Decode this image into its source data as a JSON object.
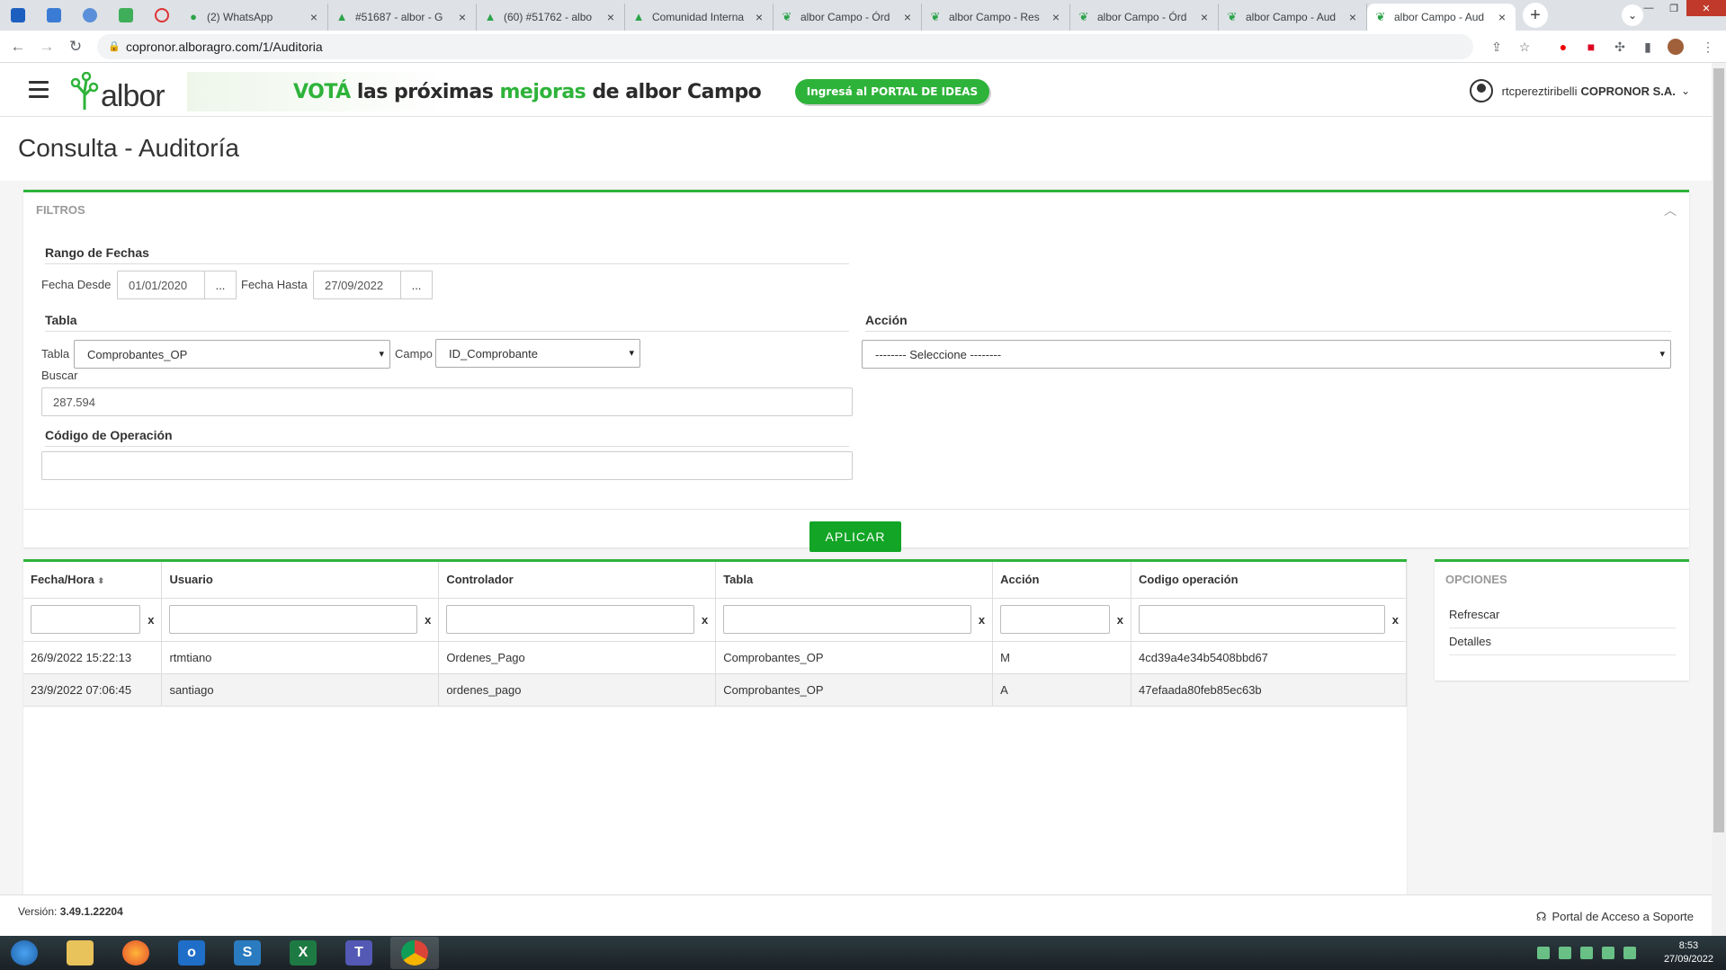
{
  "browser": {
    "tabs": [
      {
        "title": "(2) WhatsApp",
        "icon": "whatsapp-icon"
      },
      {
        "title": "#51687 - albor - G",
        "icon": "albor-icon"
      },
      {
        "title": "(60) #51762 - albo",
        "icon": "albor-icon"
      },
      {
        "title": "Comunidad Interna",
        "icon": "albor-icon"
      },
      {
        "title": "albor Campo - Órd",
        "icon": "sprout-icon"
      },
      {
        "title": "albor Campo - Res",
        "icon": "sprout-icon"
      },
      {
        "title": "albor Campo - Órd",
        "icon": "sprout-icon"
      },
      {
        "title": "albor Campo - Aud",
        "icon": "sprout-icon"
      },
      {
        "title": "albor Campo - Aud",
        "icon": "sprout-icon",
        "active": true
      }
    ],
    "url": "copronor.alboragro.com/1/Auditoria"
  },
  "header": {
    "logo_text": "albor",
    "banner": {
      "lead": "VOTÁ",
      "text_1": "las próximas",
      "highlight": "mejoras",
      "text_2": "de albor Campo",
      "cta": "Ingresá al PORTAL DE IDEAS"
    },
    "user_name": "rtcpereztiribelli",
    "company": "COPRONOR S.A."
  },
  "page": {
    "title": "Consulta - Auditoría"
  },
  "filters": {
    "title": "FILTROS",
    "rango_title": "Rango de Fechas",
    "fecha_desde_label": "Fecha Desde",
    "fecha_desde": "01/01/2020",
    "fecha_hasta_label": "Fecha Hasta",
    "fecha_hasta": "27/09/2022",
    "picker_label": "...",
    "tabla_title": "Tabla",
    "tabla_label": "Tabla",
    "tabla_value": "Comprobantes_OP",
    "campo_label": "Campo",
    "campo_value": "ID_Comprobante",
    "buscar_label": "Buscar",
    "buscar_value": "287.594",
    "accion_title": "Acción",
    "accion_value": "-------- Seleccione --------",
    "codigo_title": "Código de Operación",
    "codigo_value": "",
    "apply_label": "APLICAR"
  },
  "grid": {
    "columns": [
      "Fecha/Hora",
      "Usuario",
      "Controlador",
      "Tabla",
      "Acción",
      "Codigo operación"
    ],
    "clear_label": "x",
    "rows": [
      [
        "26/9/2022 15:22:13",
        "rtmtiano",
        "Ordenes_Pago",
        "Comprobantes_OP",
        "M",
        "4cd39a4e34b5408bbd67"
      ],
      [
        "23/9/2022 07:06:45",
        "santiago",
        "ordenes_pago",
        "Comprobantes_OP",
        "A",
        "47efaada80feb85ec63b"
      ]
    ]
  },
  "options": {
    "title": "OPCIONES",
    "items": [
      "Refrescar",
      "Detalles"
    ]
  },
  "footer": {
    "version_label": "Versión:",
    "version": "3.49.1.22204",
    "support": "Portal de Acceso a Soporte"
  },
  "taskbar": {
    "time": "8:53",
    "date": "27/09/2022"
  }
}
